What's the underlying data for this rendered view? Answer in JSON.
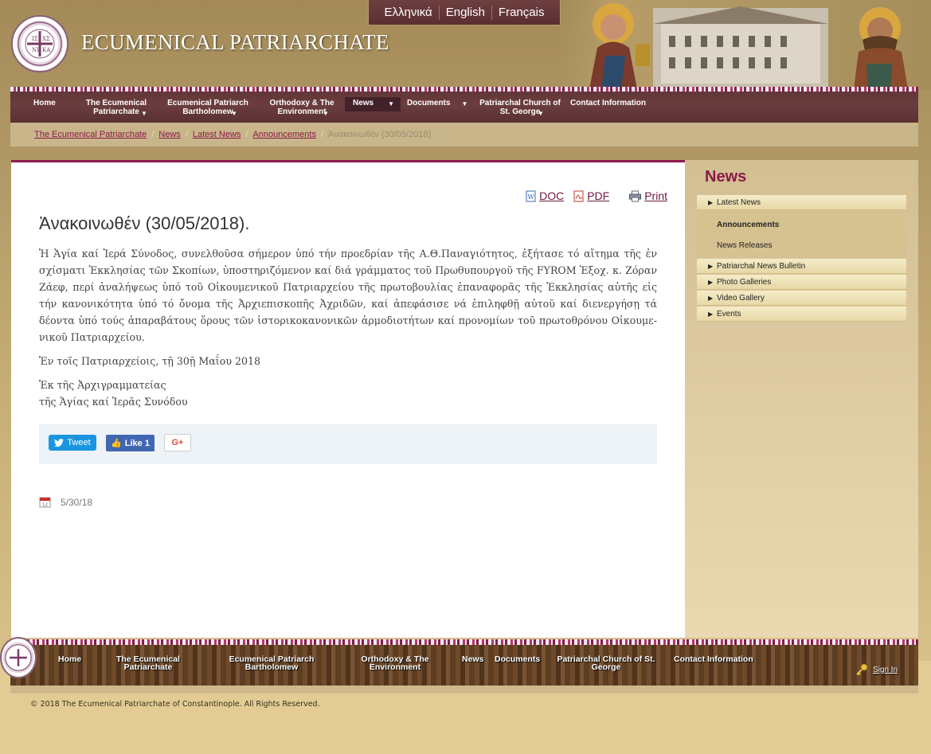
{
  "site": {
    "title": "ECUMENICAL PATRIARCHATE",
    "logo_icon": "patriarchate-seal-icon"
  },
  "languages": [
    "Ελληνικά",
    "English",
    "Français"
  ],
  "main_nav": {
    "items": [
      {
        "label": "Home",
        "has_dropdown": false
      },
      {
        "label": "The Ecumenical Patriarchate",
        "has_dropdown": true
      },
      {
        "label": "Ecumenical Patriarch Bartholomew",
        "has_dropdown": true
      },
      {
        "label": "Orthodoxy & The Environment",
        "has_dropdown": true
      },
      {
        "label": "News",
        "has_dropdown": true,
        "active": true
      },
      {
        "label": "Documents",
        "has_dropdown": true
      },
      {
        "label": "Patriarchal Church of St. George",
        "has_dropdown": true
      },
      {
        "label": "Contact Information",
        "has_dropdown": false
      }
    ]
  },
  "breadcrumb": {
    "links": [
      "The Ecumenical Patriarchate",
      "News",
      "Latest News",
      "Announcements"
    ],
    "current": "Ἀνακοινωθέν (30/05/2018)."
  },
  "doc_tools": {
    "doc": "DOC",
    "pdf": "PDF",
    "print": "Print"
  },
  "article": {
    "title": "Ἀνακοινωθέν (30/05/2018).",
    "paragraph_1": "Ἡ Ἁγία καί Ἱερά Σύνοδος, συνελθοῦσα σήμερον ὑπό τήν προεδρίαν τῆς Α.Θ.Παναγιότητος, ἐξήτασε τό αἴτημα τῆς ἐν σχίσματι Ἐκκλησίας τῶν Σκοπίων, ὑποστηριζόμενον καί διά γράμματος τοῦ Πρωθυπουργοῦ τῆς FYROM Ἐξοχ. κ. Ζόραν Ζάεφ, περί ἀναλήψεως ὑπό τοῦ Οἰκουμενικοῦ Πατριαρχείου τῆς πρωτοβουλίας ἐπαναφορᾶς τῆς Ἐκκλησίας αὐτῆς εἰς τήν κανονικότητα ὑπό τό ὄνομα τῆς Ἀρχιεπισκοπῆς Ἀχριδῶν, καί ἀπεφάσισε νά ἐπιληφθῇ αὐτοῦ καί διενεργήσῃ τά δέοντα ὑπό τούς ἀπαραβάτους ὅρους τῶν ἱστορικοκανονικῶν ἁρμοδιοτήτων καί προνομίων τοῦ πρωτοθρόνου Οἰκουμε-νικοῦ Πατριαρχείου.",
    "paragraph_2": "Ἐν τοῖς Πατριαρχείοις, τῇ 30ῇ Μαΐου 2018",
    "signature_line_1": "Ἐκ τῆς Ἀρχιγραμματείας",
    "signature_line_2": "τῆς Ἁγίας καί Ἱερᾶς Συνόδου",
    "date": "5/30/18"
  },
  "share": {
    "tweet": "Tweet",
    "like": "Like 1",
    "gplus": "G+"
  },
  "sidebar": {
    "title": "News",
    "items": [
      "Latest News",
      "Patriarchal News Bulletin",
      "Photo Galleries",
      "Video Gallery",
      "Events"
    ],
    "subitems": [
      "Announcements",
      "News Releases"
    ],
    "selected_subitem": "Announcements"
  },
  "footer_nav": {
    "items": [
      "Home",
      "The Ecumenical Patriarchate",
      "Ecumenical Patriarch Bartholomew",
      "Orthodoxy & The Environment",
      "News",
      "Documents",
      "Patriarchal Church of St. George",
      "Contact Information"
    ],
    "sign_in": "Sign In"
  },
  "copyright": "© 2018 The Ecumenical Patriarchate of Constantinople. All Rights Reserved.",
  "colors": {
    "brand_maroon": "#8e1b4c",
    "nav_bg": "#5e3436",
    "link": "#8a1a4a",
    "page_gold": "#e2cc94"
  }
}
